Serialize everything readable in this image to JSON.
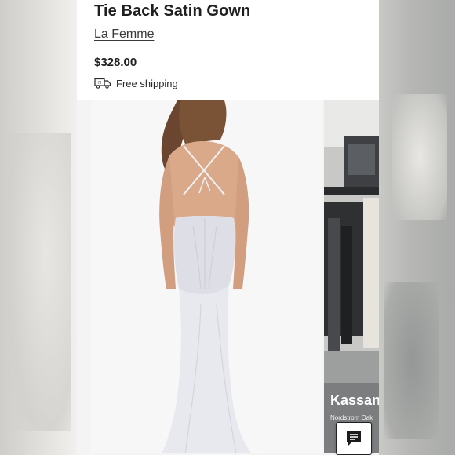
{
  "product": {
    "title": "Tie Back Satin Gown",
    "brand": "La Femme",
    "price": "$328.00",
    "shipping": "Free shipping"
  },
  "gallery": {
    "side_label": "Kassanc",
    "side_sublabel": "Nordstrom Oak"
  },
  "icons": {
    "shipping": "truck-icon",
    "chat": "chat-icon"
  },
  "colors": {
    "text": "#1f1f1f",
    "panel": "#ffffff",
    "gown": "#e9e9ef"
  }
}
